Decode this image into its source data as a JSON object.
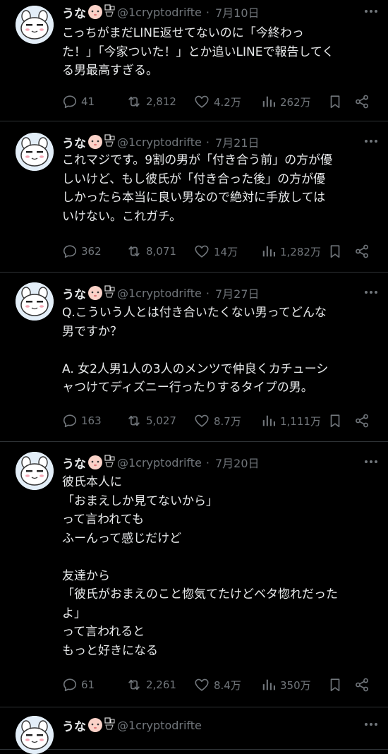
{
  "colors": {
    "background": "#000000",
    "text": "#e7e9ea",
    "muted": "#71767b",
    "divider": "#2f3336"
  },
  "tweets": [
    {
      "name": "うな",
      "handle": "@1cryptodrifte",
      "date": "7月10日",
      "lines": [
        "こっちがまだLINE返せてないのに「今終わっ",
        "た！」「今家ついた！」とか追いLINEで報告してく",
        "る男最高すぎる。"
      ],
      "replies": "41",
      "retweets": "2,812",
      "likes": "4.2万",
      "views": "262万"
    },
    {
      "name": "うな",
      "handle": "@1cryptodrifte",
      "date": "7月21日",
      "lines": [
        "これマジです。9割の男が「付き合う前」の方が優",
        "しいけど、もし彼氏が「付き合った後」の方が優",
        "しかったら本当に良い男なので絶対に手放しては",
        "いけない。これガチ。"
      ],
      "replies": "362",
      "retweets": "8,071",
      "likes": "14万",
      "views": "1,282万"
    },
    {
      "name": "うな",
      "handle": "@1cryptodrifte",
      "date": "7月27日",
      "lines": [
        "Q.こういう人とは付き合いたくない男ってどんな",
        "男ですか？",
        "",
        "A. 女2人男1人の3人のメンツで仲良くカチューシ",
        "ャつけてディズニー行ったりするタイプの男。"
      ],
      "replies": "163",
      "retweets": "5,027",
      "likes": "8.7万",
      "views": "1,111万"
    },
    {
      "name": "うな",
      "handle": "@1cryptodrifte",
      "date": "7月20日",
      "lines": [
        "彼氏本人に",
        "「おまえしか見てないから」",
        "って言われても",
        "ふーんって感じだけど",
        "",
        "友達から",
        "「彼氏がおまえのこと惚気てたけどベタ惚れだった",
        "よ」",
        "って言われると",
        "もっと好きになる"
      ],
      "replies": "61",
      "retweets": "2,261",
      "likes": "8.4万",
      "views": "350万"
    },
    {
      "name": "うな",
      "handle": "@1cryptodrifte",
      "date": "",
      "lines": [],
      "replies": "",
      "retweets": "",
      "likes": "",
      "views": ""
    }
  ]
}
